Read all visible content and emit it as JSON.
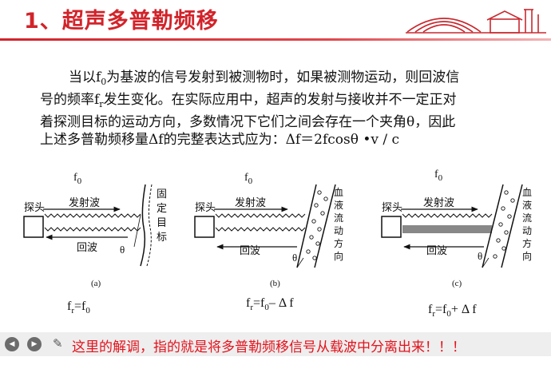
{
  "slide": {
    "title": "1、超声多普勒频移",
    "paragraph": {
      "line1": [
        "当以f",
        "0",
        "为基波的信号发射到被测物时，如果被测物运动，则回波信"
      ],
      "line2": [
        "号的频率f",
        "r",
        "发生变化。在实际应用中，超声的发射与接收并不一定正对"
      ],
      "line3": "着探测目标的运动方向，多数情况下它们之间会存在一个夹角θ，因此",
      "line4": "上述多普勒频移量Δf的完整表达式应为：Δf＝2fcosθ •v / c"
    }
  },
  "diagrams": [
    {
      "label": "(a)",
      "f0": [
        "f",
        "0"
      ],
      "probe": "探头",
      "transmit": "发射波",
      "echo": "回波",
      "angle": "θ",
      "target": [
        "固",
        "定",
        "目",
        "标"
      ],
      "formula": [
        "f",
        "r",
        "=f",
        "0",
        ""
      ]
    },
    {
      "label": "(b)",
      "f0": [
        "f",
        "0"
      ],
      "probe": "探头",
      "transmit": "发射波",
      "echo": "回波",
      "angle": "θ",
      "target": [
        "血",
        "液",
        "流",
        "动",
        "方",
        "向"
      ],
      "formula": [
        "f",
        "r",
        "=f",
        "0",
        "– Δ f"
      ]
    },
    {
      "label": "(c)",
      "f0": [
        "f",
        "0"
      ],
      "probe": "探头",
      "transmit": "发射波",
      "echo": "回波",
      "angle": "θ",
      "target": [
        "血",
        "液",
        "流",
        "动",
        "方",
        "向"
      ],
      "formula": [
        "f",
        "r",
        "=f",
        "0",
        "+ Δ f"
      ]
    }
  ],
  "player": {
    "prev_icon": "chevron-left-icon",
    "next_icon": "chevron-right-icon",
    "pen_icon": "pen-icon",
    "overlay_text": "这里的解调，指的就是将多普勒频移信号从载波中分离出来！！！",
    "overlay_color": "#e3131c"
  }
}
